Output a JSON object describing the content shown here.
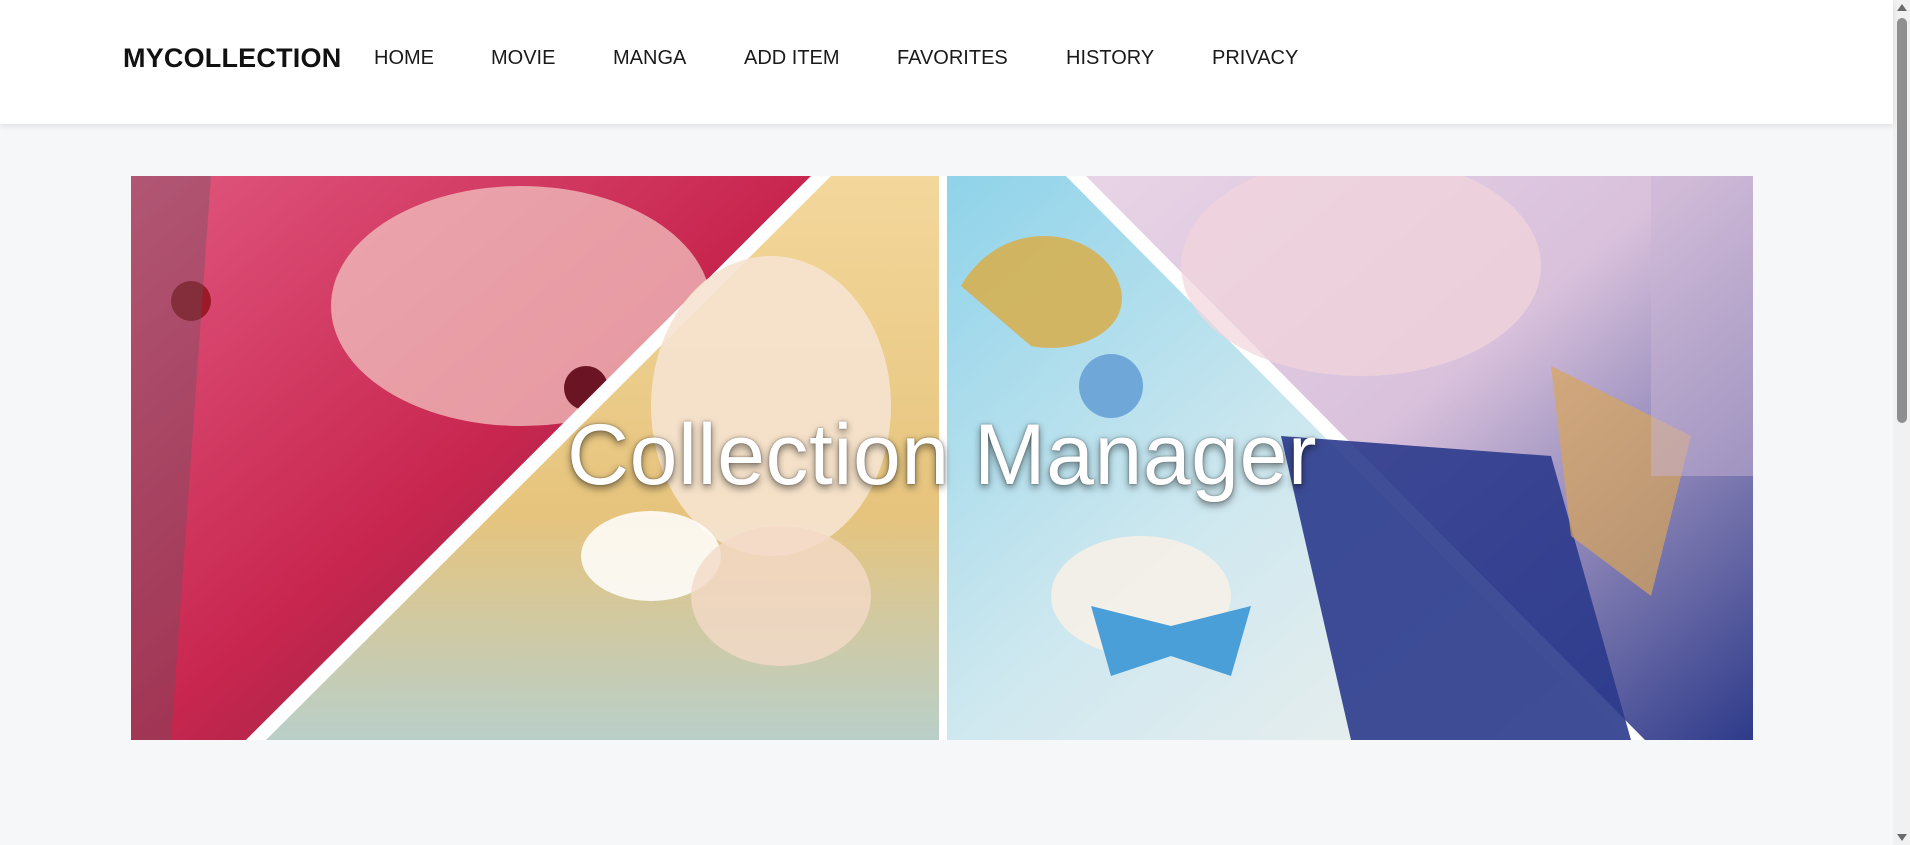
{
  "brand": "MYCOLLECTION",
  "nav": {
    "items": [
      {
        "label": "HOME"
      },
      {
        "label": "MOVIE"
      },
      {
        "label": "MANGA"
      },
      {
        "label": "ADD ITEM"
      },
      {
        "label": "FAVORITES"
      },
      {
        "label": "HISTORY"
      },
      {
        "label": "PRIVACY"
      }
    ]
  },
  "hero": {
    "title": "Collection Manager"
  },
  "colors": {
    "accent_text": "#111111",
    "nav_background": "#ffffff",
    "page_background": "#f6f7f9"
  }
}
